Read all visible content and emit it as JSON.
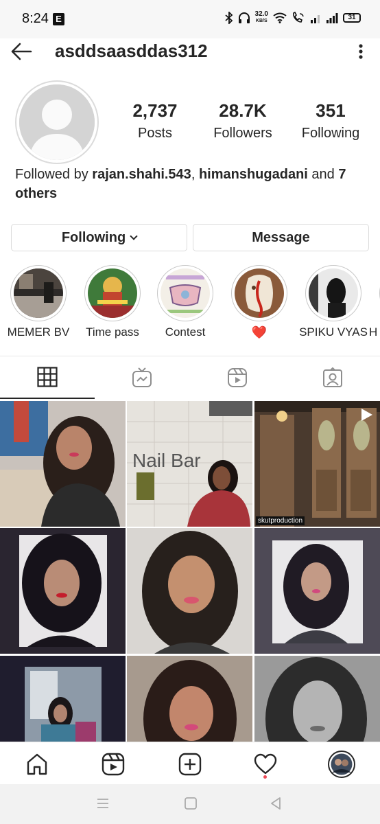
{
  "status_bar": {
    "time": "8:24",
    "e_badge": "E",
    "speed_value": "32.0",
    "speed_unit": "KB/S",
    "battery": "31"
  },
  "header": {
    "username": "asddsaasddas312"
  },
  "profile": {
    "stats": [
      {
        "value": "2,737",
        "label": "Posts"
      },
      {
        "value": "28.7K",
        "label": "Followers"
      },
      {
        "value": "351",
        "label": "Following"
      }
    ],
    "followed_by": {
      "prefix": "Followed by ",
      "user1": "rajan.shahi.543",
      "sep": ", ",
      "user2": "himanshugadani",
      "middle": " and ",
      "others": "7 others"
    },
    "following_button": "Following",
    "message_button": "Message"
  },
  "highlights": [
    {
      "label": "MEMER BV"
    },
    {
      "label": "Time pass"
    },
    {
      "label": "Contest"
    },
    {
      "label": "❤️"
    },
    {
      "label": "SPIKU VYAS"
    },
    {
      "label": "H"
    }
  ],
  "grid": {
    "tag_label": "skutproduction",
    "sign_text": "Nail Bar"
  },
  "colors": {
    "text": "#262626",
    "border": "#dbdbdb",
    "notification": "#ed4956",
    "heart": "#ed1c3a"
  },
  "icons": {
    "header": [
      "back-arrow-icon",
      "more-vertical-icon"
    ],
    "tabs": [
      "grid-icon",
      "igtv-icon",
      "reels-icon",
      "tagged-icon"
    ],
    "bottom_nav": [
      "home-icon",
      "reels-icon",
      "create-icon",
      "activity-heart-icon",
      "profile-avatar"
    ]
  }
}
